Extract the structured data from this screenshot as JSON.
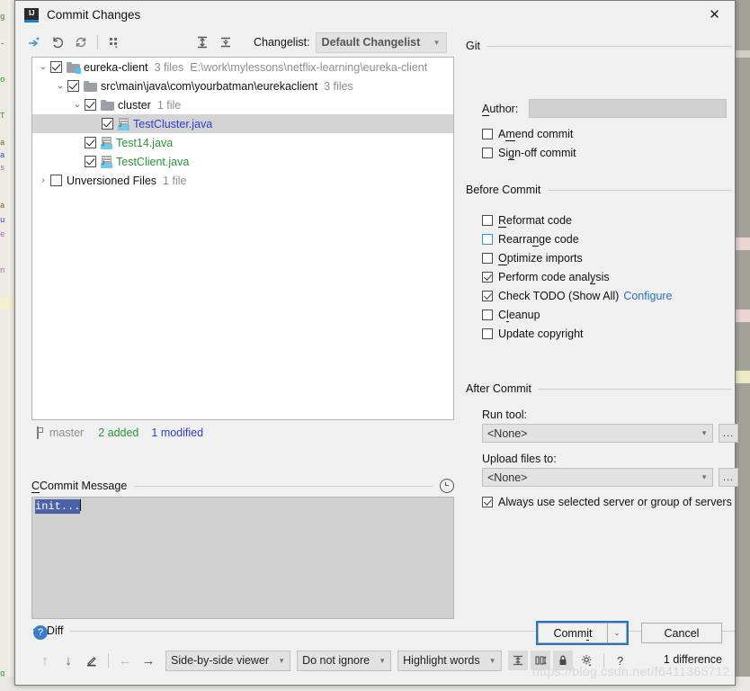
{
  "window": {
    "title": "Commit Changes",
    "app_icon": "IJ",
    "close_label": "✕"
  },
  "toolbar": {
    "buttons": [
      {
        "name": "move-to-another-changelist-icon",
        "tip": "Move to Another Changelist"
      },
      {
        "name": "rollback-icon",
        "tip": "Rollback"
      },
      {
        "name": "refresh-icon",
        "tip": "Refresh"
      },
      {
        "name": "group-by-icon",
        "tip": "Group By"
      },
      {
        "name": "expand-all-icon",
        "tip": "Expand All"
      },
      {
        "name": "collapse-all-icon",
        "tip": "Collapse All"
      }
    ],
    "changelist_label": "Changelist:",
    "changelist_value": "Default Changelist"
  },
  "tree": {
    "rows": [
      {
        "indent": 0,
        "twisty": "⌄",
        "checked": true,
        "icon": "folder-vcs",
        "name": "eureka-client",
        "style": "plain",
        "meta": "3 files",
        "meta2": "E:\\work\\mylessons\\netflix-learning\\eureka-client",
        "selected": false
      },
      {
        "indent": 1,
        "twisty": "⌄",
        "checked": true,
        "icon": "folder",
        "name": "src\\main\\java\\com\\yourbatman\\eurekaclient",
        "style": "plain",
        "meta": "3 files",
        "meta2": "",
        "selected": false
      },
      {
        "indent": 2,
        "twisty": "⌄",
        "checked": true,
        "icon": "folder",
        "name": "cluster",
        "style": "plain",
        "meta": "1 file",
        "meta2": "",
        "selected": false
      },
      {
        "indent": 3,
        "twisty": "",
        "checked": true,
        "icon": "java",
        "name": "TestCluster.java",
        "style": "mod",
        "meta": "",
        "meta2": "",
        "selected": true
      },
      {
        "indent": 2,
        "twisty": "",
        "checked": true,
        "icon": "java",
        "name": "Test14.java",
        "style": "add",
        "meta": "",
        "meta2": "",
        "selected": false
      },
      {
        "indent": 2,
        "twisty": "",
        "checked": true,
        "icon": "java",
        "name": "TestClient.java",
        "style": "add",
        "meta": "",
        "meta2": "",
        "selected": false
      },
      {
        "indent": 0,
        "twisty": "›",
        "checked": false,
        "icon": "none",
        "name": "Unversioned Files",
        "style": "plain",
        "meta": "1 file",
        "meta2": "",
        "selected": false
      }
    ]
  },
  "status": {
    "branch": "master",
    "added": "2 added",
    "modified": "1 modified"
  },
  "commit_message": {
    "label": "Commit Message",
    "label_mnemonic": "C",
    "value": "init...",
    "history_icon": "clock-icon"
  },
  "git": {
    "section": "Git",
    "author_label": "Author:",
    "author_mnemonic": "A",
    "author_value": "",
    "checkboxes": [
      {
        "label_pre": "A",
        "label_mn": "m",
        "label_post": "end commit",
        "checked": false,
        "focused": false,
        "name": "amend-commit"
      },
      {
        "label_pre": "Si",
        "label_mn": "g",
        "label_post": "n-off commit",
        "checked": false,
        "focused": false,
        "name": "sign-off-commit"
      }
    ]
  },
  "before_commit": {
    "section": "Before Commit",
    "checkboxes": [
      {
        "label_pre": "",
        "label_mn": "R",
        "label_post": "eformat code",
        "checked": false,
        "focused": false,
        "name": "reformat-code"
      },
      {
        "label_pre": "Rearra",
        "label_mn": "n",
        "label_post": "ge code",
        "checked": false,
        "focused": true,
        "name": "rearrange-code"
      },
      {
        "label_pre": "",
        "label_mn": "O",
        "label_post": "ptimize imports",
        "checked": false,
        "focused": false,
        "name": "optimize-imports"
      },
      {
        "label_pre": "Perform code anal",
        "label_mn": "y",
        "label_post": "sis",
        "checked": true,
        "focused": false,
        "name": "perform-code-analysis"
      },
      {
        "label_pre": "Check TODO (Show All)",
        "label_mn": "",
        "label_post": "",
        "checked": true,
        "focused": false,
        "name": "check-todo",
        "link": "Configure"
      },
      {
        "label_pre": "C",
        "label_mn": "l",
        "label_post": "eanup",
        "checked": false,
        "focused": false,
        "name": "cleanup"
      },
      {
        "label_pre": "Update copyright",
        "label_mn": "",
        "label_post": "",
        "checked": false,
        "focused": false,
        "name": "update-copyright"
      }
    ]
  },
  "after_commit": {
    "section": "After Commit",
    "run_tool_label": "Run tool:",
    "run_tool_value": "<None>",
    "upload_label": "Upload files to:",
    "upload_value": "<None>",
    "ellipsis": "...",
    "always_use_label": "Always use selected server or group of servers",
    "always_use_checked": true
  },
  "diff": {
    "section": "Diff",
    "twisty": "▼",
    "prev_label": "↑",
    "next_label": "↓",
    "edit_label": "✎",
    "left_label": "←",
    "right_label": "→",
    "viewer_value": "Side-by-side viewer",
    "ignore_value": "Do not ignore",
    "highlight_value": "Highlight words",
    "icons": [
      "collapse-unchanged-icon",
      "columns-icon",
      "lock-icon",
      "settings-icon"
    ],
    "help_label": "?",
    "difference_count": "1 difference"
  },
  "footer": {
    "help_icon": "?",
    "commit_label": "Commit",
    "commit_mnemonic": "i",
    "commit_dropdown": "⌄",
    "cancel_label": "Cancel"
  },
  "watermark": "https://blog.csdn.net/f6411365712",
  "colors": {
    "accent": "#2675c4",
    "added": "#2a9434",
    "modified": "#2a3fcd",
    "link": "#2a6ebd",
    "selection": "#4a62a8",
    "dialog_bg": "#f0f0f0"
  }
}
